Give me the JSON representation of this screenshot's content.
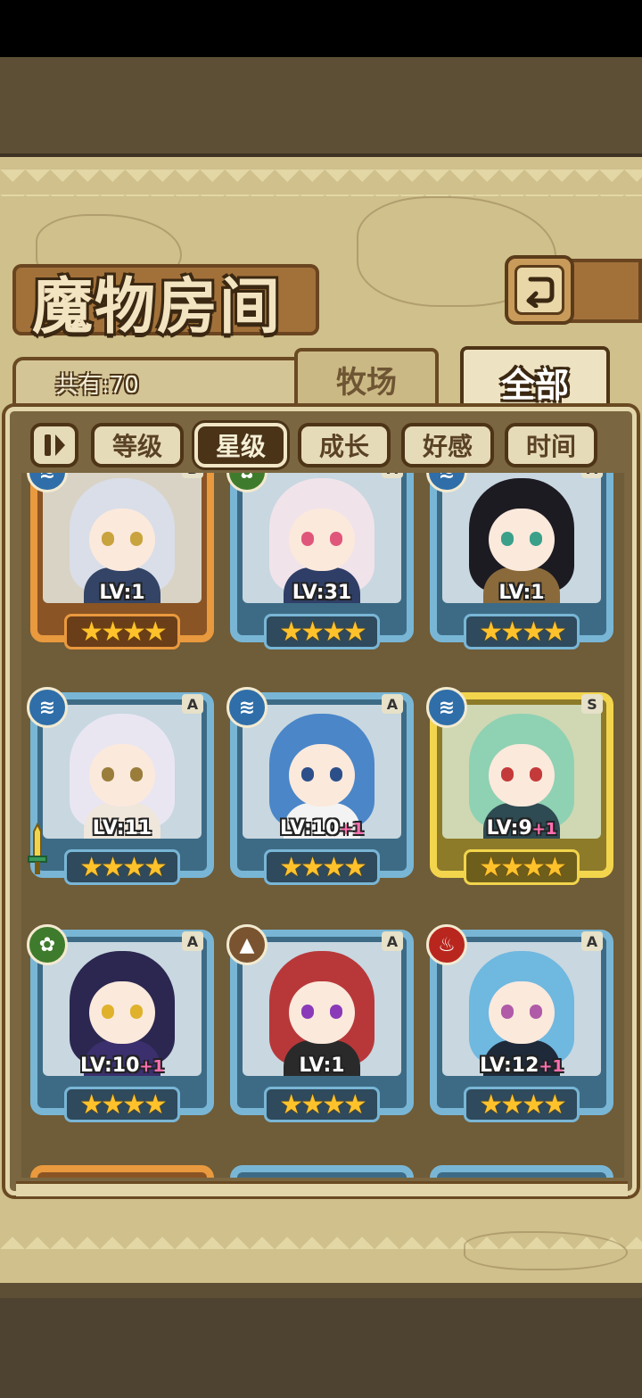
{
  "title": "魔物房间",
  "icons": {
    "back": "return-arrow-icon",
    "pause": "pause-icon"
  },
  "header": {
    "count_label": "共有:70"
  },
  "tabs": [
    {
      "label": "牧场",
      "active": false
    },
    {
      "label": "全部",
      "active": true
    }
  ],
  "filters": [
    {
      "label": "等级",
      "active": false
    },
    {
      "label": "星级",
      "active": true
    },
    {
      "label": "成长",
      "active": false
    },
    {
      "label": "好感",
      "active": false
    },
    {
      "label": "时间",
      "active": false
    }
  ],
  "monsters": [
    {
      "rank": "B",
      "level": "LV:1",
      "plus": "",
      "element": "water",
      "stars": 4,
      "frame": "bronze",
      "hair": "#d9dee8",
      "eye": "#c9a33d",
      "outfit": "#334466"
    },
    {
      "rank": "A",
      "level": "LV:31",
      "plus": "",
      "element": "grass",
      "stars": 4,
      "frame": "blue",
      "hair": "#f1e3ea",
      "eye": "#e0567a",
      "outfit": "#2e3e66"
    },
    {
      "rank": "A",
      "level": "LV:1",
      "plus": "",
      "element": "water",
      "stars": 4,
      "frame": "blue",
      "hair": "#1d1b22",
      "eye": "#3aa08a",
      "outfit": "#8a6a3a"
    },
    {
      "rank": "A",
      "level": "LV:11",
      "plus": "",
      "element": "water",
      "stars": 4,
      "frame": "blue",
      "hair": "#e9e6f2",
      "eye": "#9a7d3a",
      "outfit": "#efe6dc",
      "weapon": true
    },
    {
      "rank": "A",
      "level": "LV:10",
      "plus": "+1",
      "element": "water",
      "stars": 4,
      "frame": "blue",
      "hair": "#4a86c8",
      "eye": "#2c4f8a",
      "outfit": "#f3f3f3"
    },
    {
      "rank": "S",
      "level": "LV:9",
      "plus": "+1",
      "element": "water",
      "stars": 4,
      "frame": "gold",
      "hair": "#8fd1b3",
      "eye": "#c43a3a",
      "outfit": "#2e4a52"
    },
    {
      "rank": "A",
      "level": "LV:10",
      "plus": "+1",
      "element": "grass",
      "stars": 4,
      "frame": "blue",
      "hair": "#2b2750",
      "eye": "#e0b22c",
      "outfit": "#3b2f6e"
    },
    {
      "rank": "A",
      "level": "LV:1",
      "plus": "",
      "element": "earth",
      "stars": 4,
      "frame": "blue",
      "hair": "#b8383a",
      "eye": "#8a3ab8",
      "outfit": "#2a2a2a"
    },
    {
      "rank": "A",
      "level": "LV:12",
      "plus": "+1",
      "element": "fire",
      "stars": 4,
      "frame": "blue",
      "hair": "#6fb8e0",
      "eye": "#b05aa8",
      "outfit": "#1e2a3a"
    }
  ],
  "colors": {
    "accent_dark": "#4a3317",
    "parchment": "#cfc08c",
    "frame_blue": "#79b6d6",
    "frame_gold": "#f2d54c",
    "frame_bronze": "#e9993e"
  }
}
